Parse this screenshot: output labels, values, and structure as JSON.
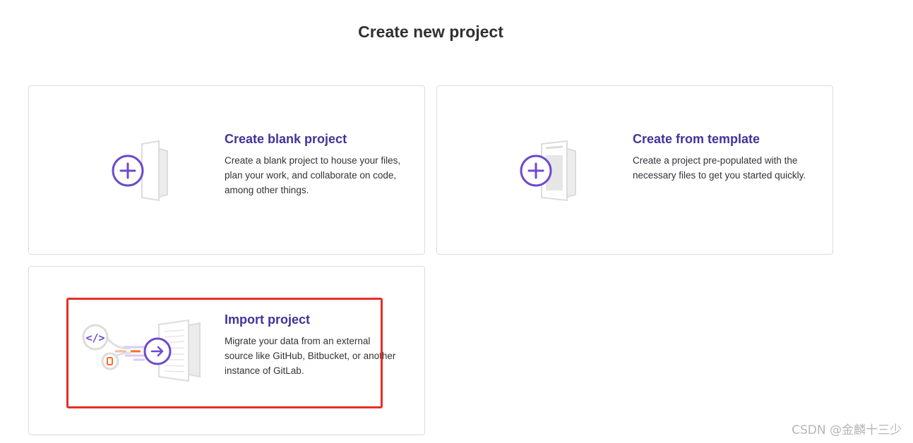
{
  "page": {
    "title": "Create new project"
  },
  "cards": {
    "blank": {
      "title": "Create blank project",
      "description": "Create a blank project to house your files, plan your work, and collaborate on code, among other things.",
      "icon": "plus-icon"
    },
    "template": {
      "title": "Create from template",
      "description": "Create a project pre-populated with the necessary files to get you started quickly.",
      "icon": "plus-icon"
    },
    "import": {
      "title": "Import project",
      "description": "Migrate your data from an external source like GitHub, Bitbucket, or another instance of GitLab.",
      "icon": "arrow-right-icon"
    }
  },
  "watermark": "CSDN @金麟十三少",
  "colors": {
    "accent": "#6e49cb",
    "title_text": "#41349a",
    "highlight": "#e52f25",
    "card_border": "#dcdcde"
  }
}
